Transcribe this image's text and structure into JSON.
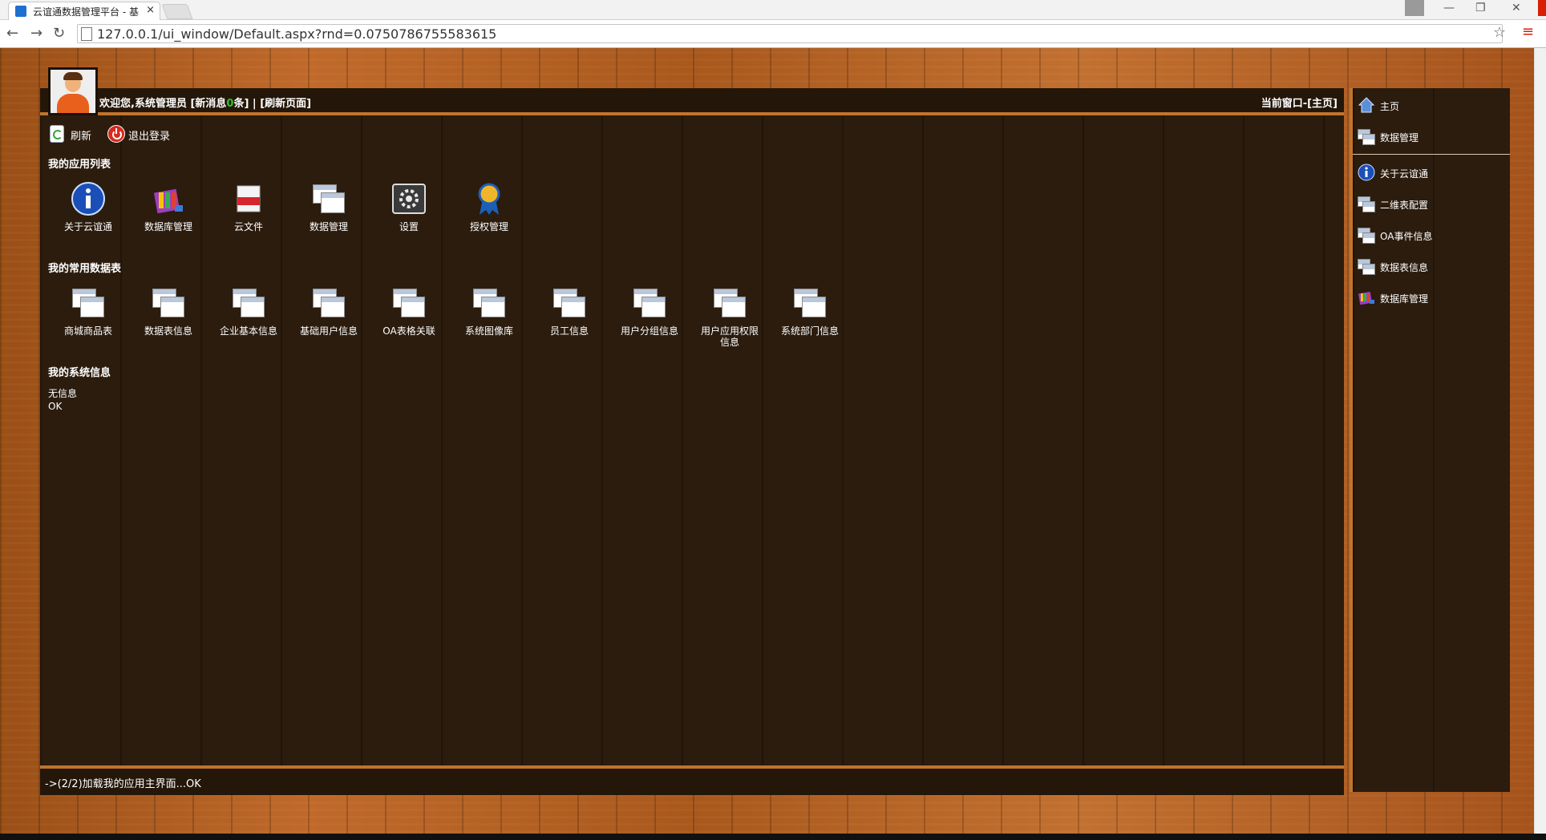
{
  "browser": {
    "tab_title": "云谊通数据管理平台 - 基",
    "tab_close": "×",
    "url": "127.0.0.1/ui_window/Default.aspx?rnd=0.0750786755583615",
    "back": "←",
    "forward": "→",
    "reload": "↻",
    "star": "☆",
    "menu": "≡",
    "minimize": "—",
    "restore": "❐",
    "close": "✕"
  },
  "header": {
    "welcome_prefix": "欢迎您,系统管理员 [新消息",
    "new_count": "0",
    "welcome_suffix": "条] | [刷新页面]",
    "current_window": "当前窗口-[主页]"
  },
  "toolbar": {
    "refresh": "刷新",
    "logout": "退出登录"
  },
  "sections": {
    "apps_title": "我的应用列表",
    "tables_title": "我的常用数据表",
    "sysinfo_title": "我的系统信息"
  },
  "apps": [
    {
      "label": "关于云谊通",
      "icon": "info-icon"
    },
    {
      "label": "数据库管理",
      "icon": "database-manager-icon"
    },
    {
      "label": "云文件",
      "icon": "cloud-file-icon"
    },
    {
      "label": "数据管理",
      "icon": "window-icon"
    },
    {
      "label": "设置",
      "icon": "settings-icon"
    },
    {
      "label": "授权管理",
      "icon": "ribbon-award-icon"
    }
  ],
  "tables": [
    {
      "label": "商城商品表"
    },
    {
      "label": "数据表信息"
    },
    {
      "label": "企业基本信息"
    },
    {
      "label": "基础用户信息"
    },
    {
      "label": "OA表格关联"
    },
    {
      "label": "系统图像库"
    },
    {
      "label": "员工信息"
    },
    {
      "label": "用户分组信息"
    },
    {
      "label": "用户应用权限信息"
    },
    {
      "label": "系统部门信息"
    }
  ],
  "sysinfo": {
    "line1": "无信息",
    "line2": "OK"
  },
  "status": "->(2/2)加载我的应用主界面...OK",
  "sidebar": {
    "items": [
      {
        "label": "主页",
        "icon": "home-icon"
      },
      {
        "label": "数据管理",
        "icon": "window-icon"
      },
      {
        "label": "关于云谊通",
        "icon": "info-icon"
      },
      {
        "label": "二维表配置",
        "icon": "window-icon"
      },
      {
        "label": "OA事件信息",
        "icon": "window-icon"
      },
      {
        "label": "数据表信息",
        "icon": "window-icon"
      },
      {
        "label": "数据库管理",
        "icon": "database-manager-icon"
      }
    ]
  },
  "colors": {
    "accent": "#c0742e",
    "panel": "#2b1c0e",
    "new_count": "#28c628"
  }
}
